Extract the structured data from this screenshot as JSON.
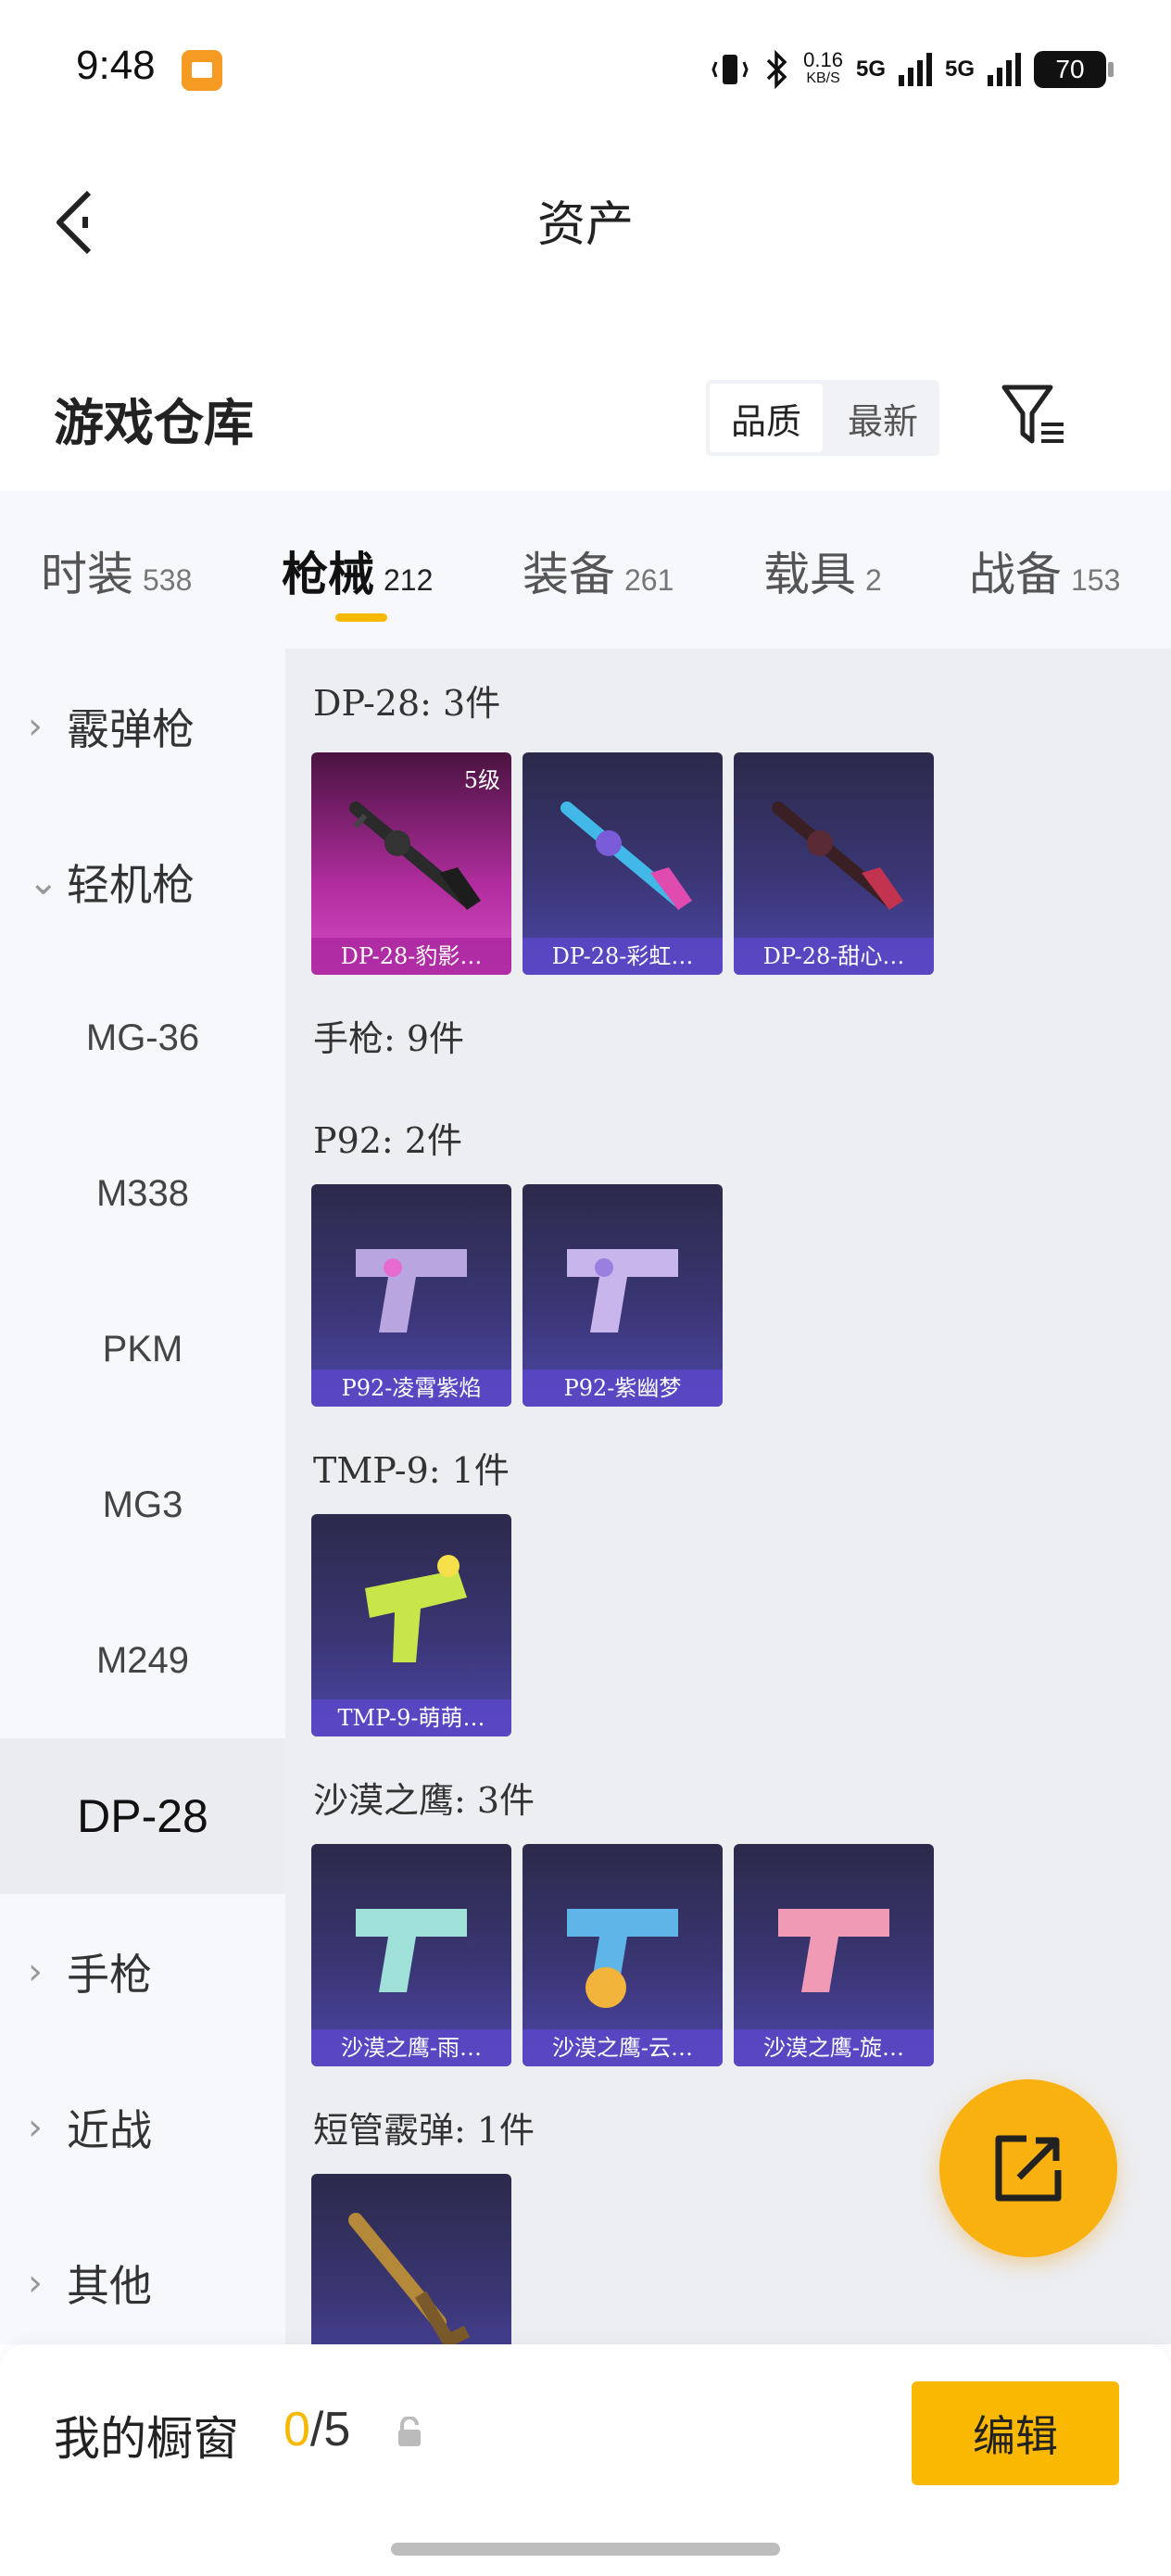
{
  "status_bar": {
    "time": "9:48",
    "net_speed_value": "0.16",
    "net_speed_unit": "KB/S",
    "signal1": "5G",
    "signal2": "5G",
    "battery": "70"
  },
  "header": {
    "title": "资产"
  },
  "warehouse": {
    "title": "游戏仓库",
    "sort_options": [
      "品质",
      "最新"
    ]
  },
  "tabs": [
    {
      "label": "时装",
      "count": "538"
    },
    {
      "label": "枪械",
      "count": "212"
    },
    {
      "label": "装备",
      "count": "261"
    },
    {
      "label": "载具",
      "count": "2"
    },
    {
      "label": "战备",
      "count": "153"
    }
  ],
  "sidebar": {
    "items": [
      {
        "label": "霰弹枪",
        "chevron": "›"
      },
      {
        "label": "轻机枪",
        "chevron": "⌄"
      },
      {
        "label": "MG-36"
      },
      {
        "label": "M338"
      },
      {
        "label": "PKM"
      },
      {
        "label": "MG3"
      },
      {
        "label": "M249"
      },
      {
        "label": "DP-28"
      },
      {
        "label": "手枪",
        "chevron": "›"
      },
      {
        "label": "近战",
        "chevron": "›"
      },
      {
        "label": "其他",
        "chevron": "›"
      }
    ]
  },
  "content": {
    "groups": [
      {
        "heading": "DP-28: 3件",
        "items": [
          {
            "name": "DP-28-豹影…",
            "level": "5级"
          },
          {
            "name": "DP-28-彩虹…"
          },
          {
            "name": "DP-28-甜心…"
          }
        ]
      },
      {
        "heading": "手枪: 9件",
        "items": []
      },
      {
        "heading": "P92: 2件",
        "items": [
          {
            "name": "P92-凌霄紫焰"
          },
          {
            "name": "P92-紫幽梦"
          }
        ]
      },
      {
        "heading": "TMP-9: 1件",
        "items": [
          {
            "name": "TMP-9-萌萌…"
          }
        ]
      },
      {
        "heading": "沙漠之鹰: 3件",
        "items": [
          {
            "name": "沙漠之鹰-雨…"
          },
          {
            "name": "沙漠之鹰-云…"
          },
          {
            "name": "沙漠之鹰-旋…"
          }
        ]
      },
      {
        "heading": "短管霰弹: 1件",
        "items": [
          {
            "name": ""
          }
        ]
      }
    ]
  },
  "bottom": {
    "showcase_label": "我的橱窗",
    "count_current": "0",
    "count_total": "/5",
    "edit_label": "编辑"
  },
  "colors": {
    "accent": "#fbb800",
    "fab": "#f9b10f",
    "card": "#3a3674"
  }
}
